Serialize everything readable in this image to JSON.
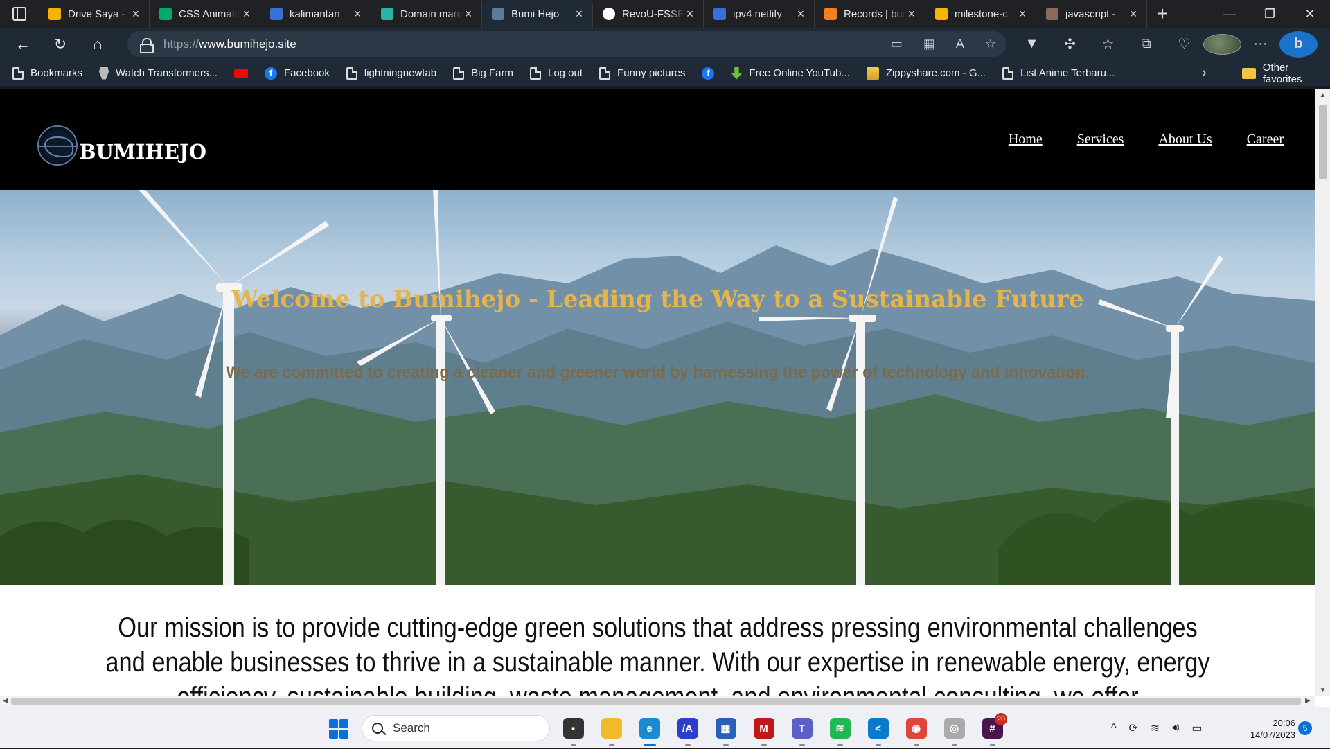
{
  "browser": {
    "tabs": [
      {
        "title": "Drive Saya - Google Drive",
        "favicon": "google-drive-icon",
        "active": false
      },
      {
        "title": "CSS Animation",
        "favicon": "w3schools-icon",
        "active": false
      },
      {
        "title": "kalimantan",
        "favicon": "search-icon",
        "active": false
      },
      {
        "title": "Domain management",
        "favicon": "netlify-icon",
        "active": false
      },
      {
        "title": "Bumi Hejo",
        "favicon": "globe-icon",
        "active": true
      },
      {
        "title": "RevoU-FSSE",
        "favicon": "github-icon",
        "active": false
      },
      {
        "title": "ipv4 netlify",
        "favicon": "search-icon",
        "active": false
      },
      {
        "title": "Records | bumihejo",
        "favicon": "cloudflare-icon",
        "active": false
      },
      {
        "title": "milestone-c",
        "favicon": "google-drive-icon",
        "active": false
      },
      {
        "title": "javascript - ",
        "favicon": "stack-icon",
        "active": false
      }
    ],
    "url": {
      "protocol": "https://",
      "host": "www.bumihejo.site"
    },
    "bookmarks": [
      {
        "label": "Bookmarks",
        "icon": "page-icon"
      },
      {
        "label": "Watch Transformers...",
        "icon": "transformers-icon"
      },
      {
        "label": "",
        "icon": "youtube-icon"
      },
      {
        "label": "Facebook",
        "icon": "facebook-icon"
      },
      {
        "label": "lightningnewtab",
        "icon": "page-icon"
      },
      {
        "label": "Big Farm",
        "icon": "page-icon"
      },
      {
        "label": "Log out",
        "icon": "page-icon"
      },
      {
        "label": "Funny pictures",
        "icon": "page-icon"
      },
      {
        "label": "",
        "icon": "facebook-icon"
      },
      {
        "label": "Free Online YouTub...",
        "icon": "download-icon"
      },
      {
        "label": "Zippyshare.com - G...",
        "icon": "zippyshare-icon"
      },
      {
        "label": "List Anime Terbaru...",
        "icon": "page-icon"
      }
    ],
    "other_favorites": "Other favorites"
  },
  "site": {
    "logo_text": "BUMIHEJO",
    "nav": [
      "Home",
      "Services",
      "About Us",
      "Career"
    ],
    "hero": {
      "title": "Welcome to Bumihejo - Leading the Way to a Sustainable Future",
      "subtitle": "We are committed to creating a cleaner and greener world by harnessing the power of technology and innovation."
    },
    "mission": "Our mission is to provide cutting-edge green solutions that address pressing environmental challenges and enable businesses to thrive in a sustainable manner. With our expertise in renewable energy, energy efficiency, sustainable building, waste management, and environmental consulting, we offer comprehensive and customized solutions tailored to"
  },
  "taskbar": {
    "search_placeholder": "Search",
    "apps": [
      {
        "name": "file-viewer-icon",
        "color": "#333333",
        "glyph": "▪"
      },
      {
        "name": "file-explorer-icon",
        "color": "#f2b92b",
        "glyph": ""
      },
      {
        "name": "edge-icon",
        "color": "#1b8ad3",
        "glyph": "e"
      },
      {
        "name": "code-editor-icon",
        "color": "#2b3fc9",
        "glyph": "/A"
      },
      {
        "name": "store-icon",
        "color": "#2a5fb8",
        "glyph": "▦"
      },
      {
        "name": "mcafee-icon",
        "color": "#c01818",
        "glyph": "M"
      },
      {
        "name": "teams-icon",
        "color": "#5b5fc7",
        "glyph": "T"
      },
      {
        "name": "spotify-icon",
        "color": "#1db954",
        "glyph": "≋"
      },
      {
        "name": "vscode-icon",
        "color": "#0a7acc",
        "glyph": "<"
      },
      {
        "name": "chrome-icon",
        "color": "#e0453a",
        "glyph": "◉"
      },
      {
        "name": "wifi-app-icon",
        "color": "#aaaaaa",
        "glyph": "◎"
      },
      {
        "name": "slack-icon",
        "color": "#4a154b",
        "glyph": "#",
        "badge": "20"
      }
    ],
    "time": "20:06",
    "date": "14/07/2023",
    "notifications": "5"
  }
}
